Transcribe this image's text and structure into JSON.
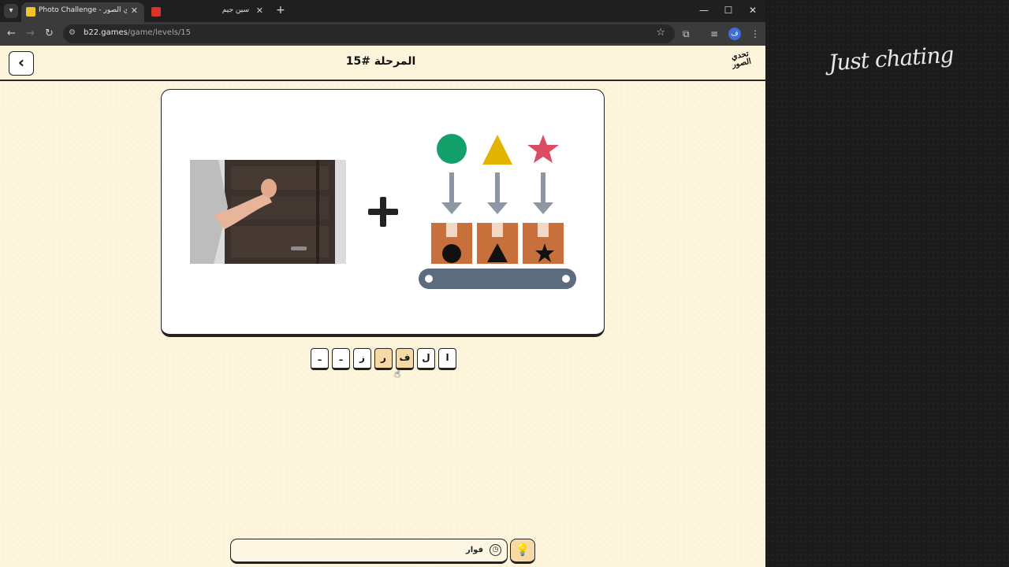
{
  "browser": {
    "tabs": [
      {
        "title": "Photo Challenge - تحدي الصور",
        "active": true
      },
      {
        "title": "سين جيم",
        "active": false
      }
    ],
    "url_domain": "b22.games",
    "url_path": "/game/levels/15"
  },
  "icons": {
    "tab_search": "▾",
    "close": "✕",
    "new_tab": "+",
    "minimize": "—",
    "maximize": "☐",
    "win_close": "✕",
    "back": "←",
    "forward": "→",
    "reload": "↻",
    "site_info": "⚙",
    "bookmark": "☆",
    "extensions": "⧉",
    "media": "≡",
    "menu": "⋮",
    "back_chevron": "‹",
    "cursor": "☝",
    "clock": "◷",
    "lightbulb": "💡"
  },
  "profile_initial": "ف",
  "page": {
    "level_title": "المرحلة #15",
    "logo_text": "تحدي الصور"
  },
  "puzzle": {
    "photo_subject": "knocking on door",
    "shapes": [
      "circle",
      "triangle",
      "star"
    ],
    "shape_colors": {
      "circle": "#13a06b",
      "triangle": "#e2b400",
      "star": "#db4c63"
    },
    "box_color": "#c8703c",
    "belt_color": "#5d6b7e"
  },
  "letter_slots": [
    "ا",
    "ل",
    "ف",
    "ر",
    "ز",
    "ـ",
    "ـ"
  ],
  "answer": {
    "text": "فوار"
  },
  "right_panel": {
    "overlay_text": "Just chating"
  }
}
